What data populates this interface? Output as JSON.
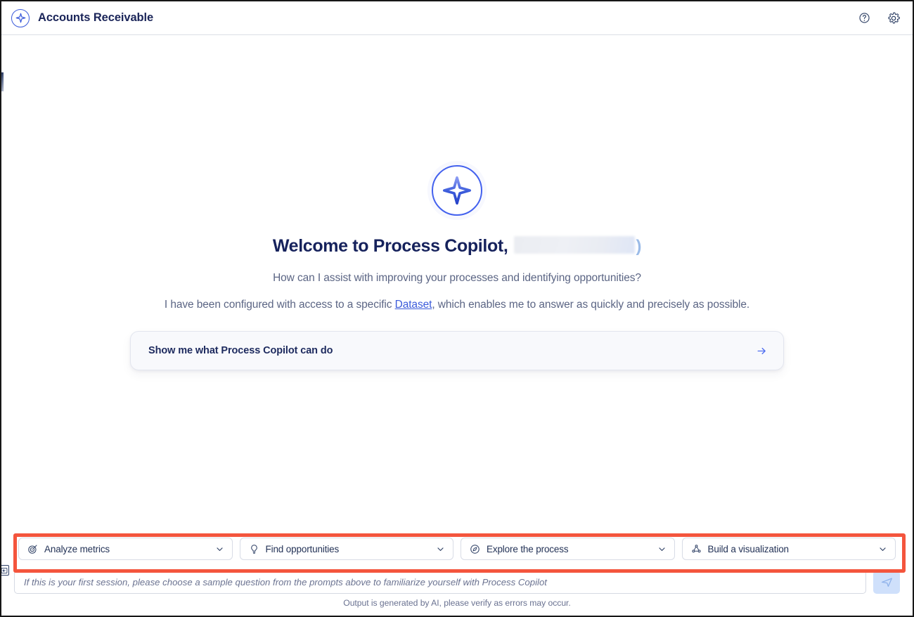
{
  "header": {
    "title": "Accounts Receivable",
    "logo_icon": "sparkle-circle-icon",
    "help_icon": "help-circle-icon",
    "settings_icon": "gear-icon"
  },
  "welcome": {
    "hero_icon": "sparkle-circle-icon",
    "greeting": "Welcome to Process Copilot,",
    "redacted_name": "",
    "redacted_tail": ")",
    "subtitle": "How can I assist with improving your processes and identifying opportunities?",
    "config_prefix": "I have been configured with access to a specific ",
    "config_link": "Dataset",
    "config_suffix": ", which enables me to answer as quickly and precisely as possible."
  },
  "suggestion": {
    "label": "Show me what Process Copilot can do",
    "arrow_icon": "arrow-right-icon"
  },
  "prompt_chips": [
    {
      "label": "Analyze metrics",
      "icon": "target-icon",
      "caret": "chevron-down-icon"
    },
    {
      "label": "Find opportunities",
      "icon": "lightbulb-icon",
      "caret": "chevron-down-icon"
    },
    {
      "label": "Explore the process",
      "icon": "compass-icon",
      "caret": "chevron-down-icon"
    },
    {
      "label": "Build a visualization",
      "icon": "network-chart-icon",
      "caret": "chevron-down-icon"
    }
  ],
  "composer": {
    "value": "",
    "placeholder": "If this is your first session, please choose a sample question from the prompts above to familiarize yourself with Process Copilot",
    "send_icon": "send-paper-plane-icon"
  },
  "disclaimer": "Output is generated by AI, please verify as errors may occur.",
  "annotation": {
    "highlight_color": "#f4553d"
  },
  "collapse_handle": {
    "icon": "collapse-panel-icon"
  },
  "colors": {
    "brand_blue": "#3b5bdb",
    "link_blue": "#3b5bdb",
    "title_navy": "#1b2559",
    "body_gray": "#5b6584",
    "highlight_red": "#f4553d",
    "send_bg": "#cfe0fb"
  }
}
